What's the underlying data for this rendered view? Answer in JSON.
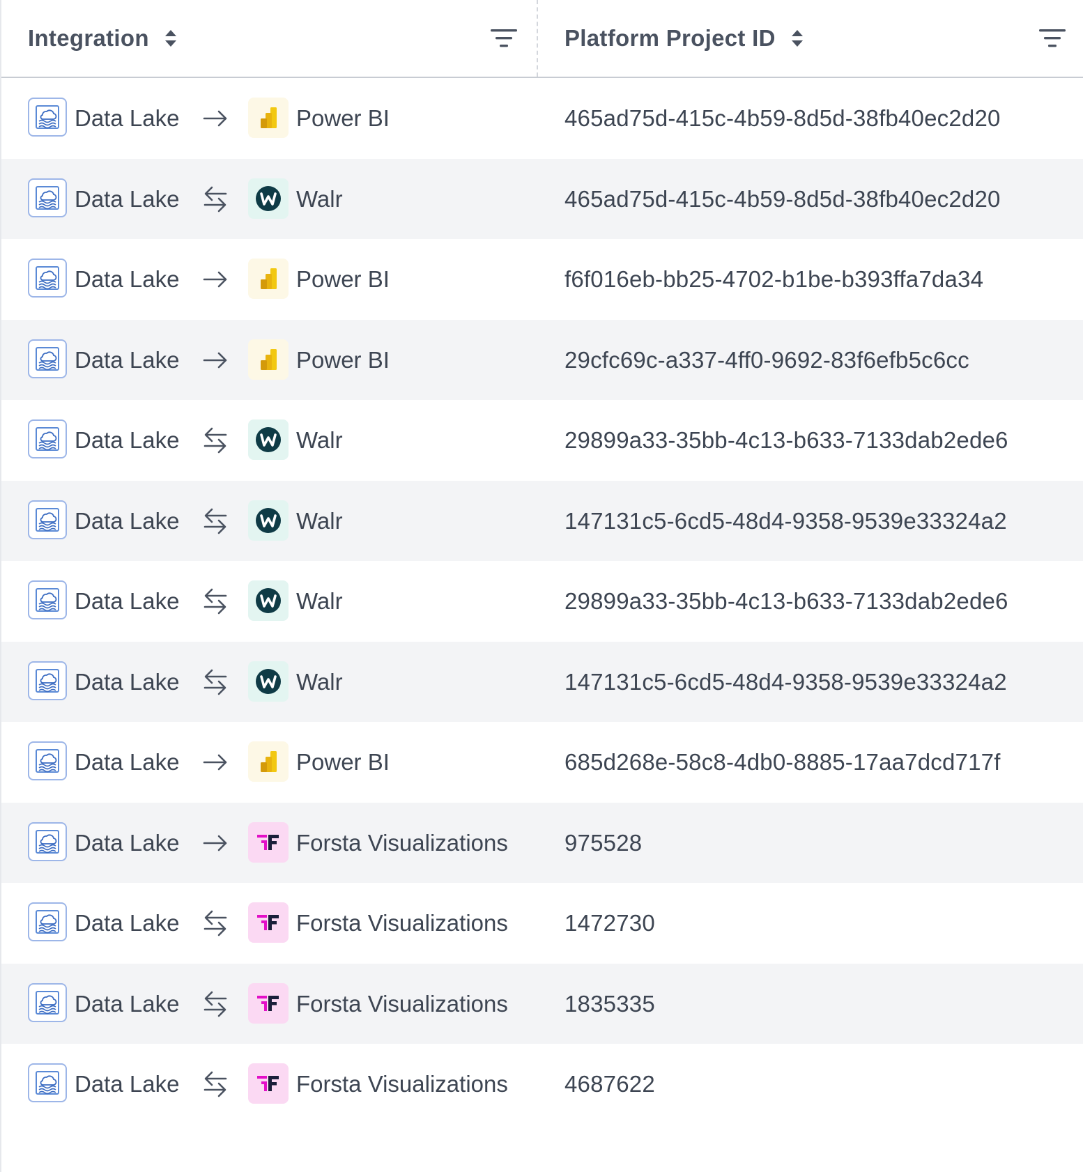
{
  "header": {
    "integration_label": "Integration",
    "project_id_label": "Platform Project ID"
  },
  "colors": {
    "powerbi_yellow": "#f2c811",
    "walr_dark": "#0f3b46",
    "forsta_magenta": "#e30fc7",
    "forsta_dark": "#1a1f3a",
    "source_icon_border": "#9db6e8",
    "row_alt_bg": "#f3f4f6"
  },
  "rows": [
    {
      "source": "Data Lake",
      "direction": "one-way",
      "destination": "Power BI",
      "dest_icon": "powerbi-icon",
      "project_id": "465ad75d-415c-4b59-8d5d-38fb40ec2d20"
    },
    {
      "source": "Data Lake",
      "direction": "two-way",
      "destination": "Walr",
      "dest_icon": "walr-icon",
      "project_id": "465ad75d-415c-4b59-8d5d-38fb40ec2d20"
    },
    {
      "source": "Data Lake",
      "direction": "one-way",
      "destination": "Power BI",
      "dest_icon": "powerbi-icon",
      "project_id": "f6f016eb-bb25-4702-b1be-b393ffa7da34"
    },
    {
      "source": "Data Lake",
      "direction": "one-way",
      "destination": "Power BI",
      "dest_icon": "powerbi-icon",
      "project_id": "29cfc69c-a337-4ff0-9692-83f6efb5c6cc"
    },
    {
      "source": "Data Lake",
      "direction": "two-way",
      "destination": "Walr",
      "dest_icon": "walr-icon",
      "project_id": "29899a33-35bb-4c13-b633-7133dab2ede6"
    },
    {
      "source": "Data Lake",
      "direction": "two-way",
      "destination": "Walr",
      "dest_icon": "walr-icon",
      "project_id": "147131c5-6cd5-48d4-9358-9539e33324a2"
    },
    {
      "source": "Data Lake",
      "direction": "two-way",
      "destination": "Walr",
      "dest_icon": "walr-icon",
      "project_id": "29899a33-35bb-4c13-b633-7133dab2ede6"
    },
    {
      "source": "Data Lake",
      "direction": "two-way",
      "destination": "Walr",
      "dest_icon": "walr-icon",
      "project_id": "147131c5-6cd5-48d4-9358-9539e33324a2"
    },
    {
      "source": "Data Lake",
      "direction": "one-way",
      "destination": "Power BI",
      "dest_icon": "powerbi-icon",
      "project_id": "685d268e-58c8-4db0-8885-17aa7dcd717f"
    },
    {
      "source": "Data Lake",
      "direction": "one-way",
      "destination": "Forsta Visualizations",
      "dest_icon": "forsta-icon",
      "project_id": "975528"
    },
    {
      "source": "Data Lake",
      "direction": "two-way",
      "destination": "Forsta Visualizations",
      "dest_icon": "forsta-icon",
      "project_id": "1472730"
    },
    {
      "source": "Data Lake",
      "direction": "two-way",
      "destination": "Forsta Visualizations",
      "dest_icon": "forsta-icon",
      "project_id": "1835335"
    },
    {
      "source": "Data Lake",
      "direction": "two-way",
      "destination": "Forsta Visualizations",
      "dest_icon": "forsta-icon",
      "project_id": "4687622"
    }
  ]
}
